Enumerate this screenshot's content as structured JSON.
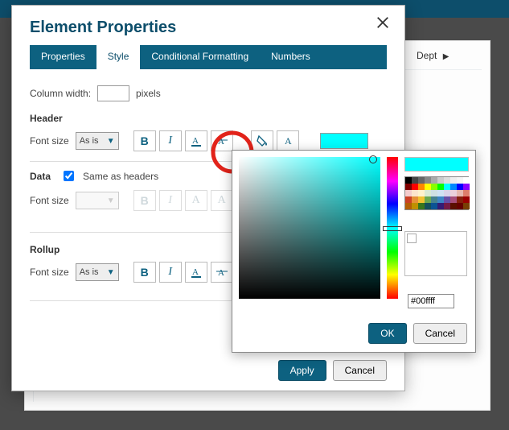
{
  "workspace": {
    "dept_label": "Dept"
  },
  "dialog": {
    "title": "Element Properties",
    "tabs": {
      "properties": "Properties",
      "style": "Style",
      "conditional": "Conditional Formatting",
      "numbers": "Numbers"
    },
    "column_width_label": "Column width:",
    "pixels_label": "pixels",
    "column_width_value": "",
    "sections": {
      "header": "Header",
      "data": "Data",
      "rollup": "Rollup"
    },
    "font_size_label": "Font size",
    "font_size_value": "As is",
    "same_as_headers_label": "Same as headers",
    "same_as_headers_checked": true,
    "footer": {
      "apply": "Apply",
      "cancel": "Cancel"
    }
  },
  "color_picker": {
    "preview_color": "#00ffff",
    "hex_value": "#00ffff",
    "ok": "OK",
    "cancel": "Cancel",
    "swatches": [
      "#000000",
      "#444444",
      "#666666",
      "#888888",
      "#aaaaaa",
      "#cccccc",
      "#dddddd",
      "#eeeeee",
      "#f5f5f5",
      "#ffffff",
      "#800000",
      "#ff0000",
      "#ff8800",
      "#ffff00",
      "#88ff00",
      "#00ff00",
      "#00ffff",
      "#0088ff",
      "#0000ff",
      "#8800ff",
      "#f4cccc",
      "#fce5cd",
      "#fff2cc",
      "#d9ead3",
      "#d0e0e3",
      "#cfe2f3",
      "#d9d2e9",
      "#ead1dc",
      "#e6b8af",
      "#dd7e6b",
      "#cc4125",
      "#e69138",
      "#f1c232",
      "#6aa84f",
      "#45818e",
      "#3d85c6",
      "#674ea7",
      "#a64d79",
      "#85200c",
      "#990000",
      "#b45f06",
      "#bf9000",
      "#38761d",
      "#134f5c",
      "#0b5394",
      "#351c75",
      "#741b47",
      "#5b0f00",
      "#660000",
      "#783f04"
    ]
  }
}
